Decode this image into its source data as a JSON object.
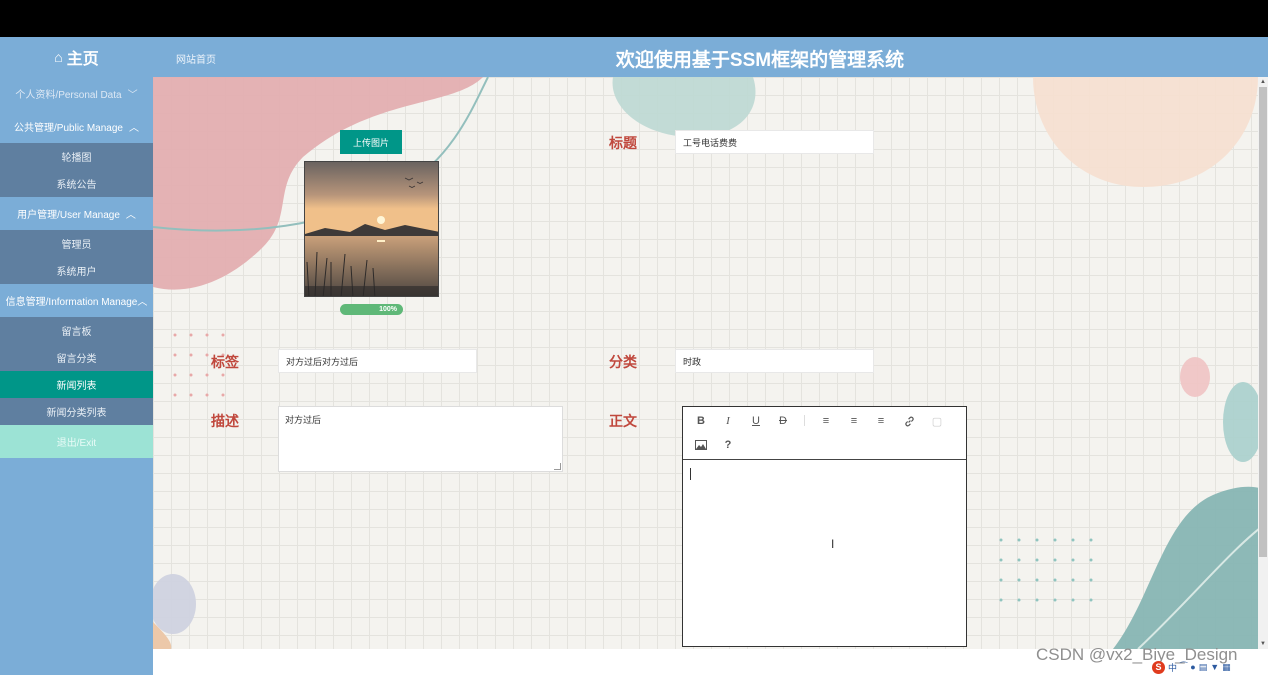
{
  "header": {
    "home_label": "主页",
    "site_home_label": "网站首页",
    "title": "欢迎使用基于SSM框架的管理系统"
  },
  "sidebar": {
    "groups": [
      {
        "label": "个人资料/Personal Data",
        "expanded": false,
        "items": []
      },
      {
        "label": "公共管理/Public Manage",
        "expanded": true,
        "items": [
          {
            "label": "轮播图"
          },
          {
            "label": "系统公告"
          }
        ]
      },
      {
        "label": "用户管理/User Manage",
        "expanded": true,
        "items": [
          {
            "label": "管理员"
          },
          {
            "label": "系统用户"
          }
        ]
      },
      {
        "label": "信息管理/Information Manage",
        "expanded": true,
        "items": [
          {
            "label": "留言板"
          },
          {
            "label": "留言分类"
          },
          {
            "label": "新闻列表",
            "active": true
          },
          {
            "label": "新闻分类列表"
          }
        ]
      }
    ],
    "exit_label": "退出/Exit"
  },
  "form": {
    "upload_label": "上传图片",
    "progress_text": "100%",
    "progress_value": 100,
    "title_label": "标题",
    "title_value": "工号电话费费",
    "tag_label": "标签",
    "tag_value": "对方过后对方过后",
    "category_label": "分类",
    "category_value": "时政",
    "desc_label": "描述",
    "desc_value": "对方过后",
    "content_label": "正文",
    "content_value": ""
  },
  "editor": {
    "tools": [
      "bold-icon",
      "italic-icon",
      "underline-icon",
      "strikethrough-icon",
      "align-left-icon",
      "align-center-icon",
      "align-right-icon",
      "link-icon",
      "unlink-icon",
      "image-icon",
      "help-icon"
    ]
  },
  "watermark": "CSDN @vx2_Biye_Design",
  "ime": {
    "logo": "S",
    "mode": "中"
  },
  "colors": {
    "header": "#7badd7",
    "sidebar_sub": "#5f7fa0",
    "active": "#009688",
    "exit": "#9ce3d5",
    "label": "#c0483d",
    "progress": "#5fb878"
  }
}
